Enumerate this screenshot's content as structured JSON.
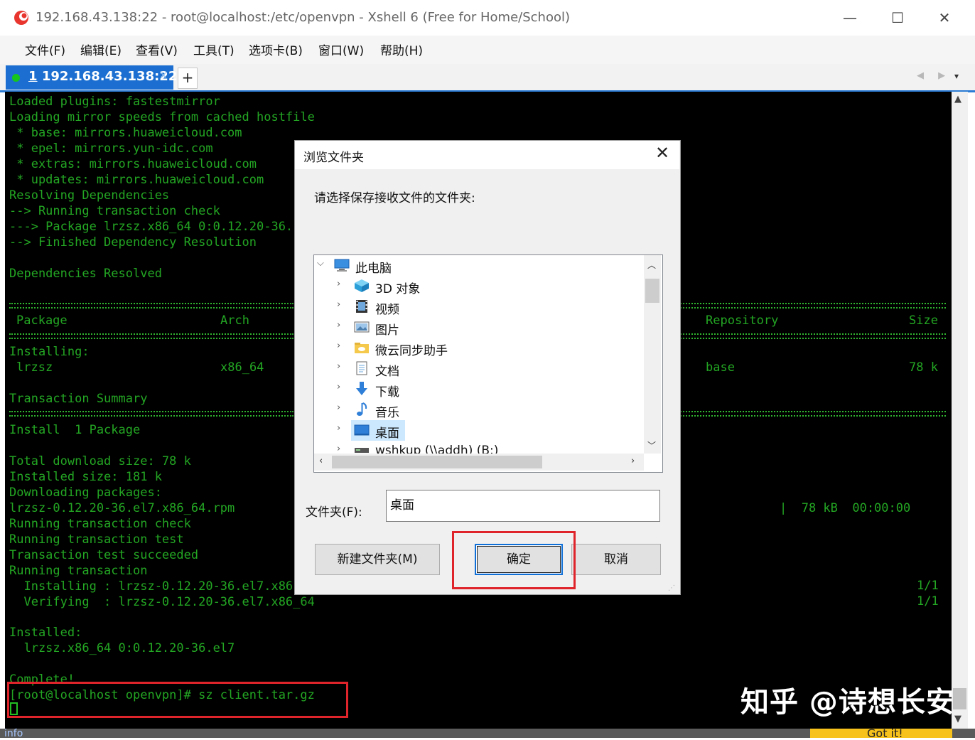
{
  "window": {
    "title": "192.168.43.138:22 - root@localhost:/etc/openvpn - Xshell 6 (Free for Home/School)",
    "minimize_label": "—",
    "maximize_label": "☐",
    "close_label": "✕"
  },
  "menu": [
    "文件(F)",
    "编辑(E)",
    "查看(V)",
    "工具(T)",
    "选项卡(B)",
    "窗口(W)",
    "帮助(H)"
  ],
  "tabs": {
    "active": {
      "index": "1",
      "host": "192.168.43.138:22",
      "close": "×"
    },
    "add_label": "+",
    "nav_label": "◀ ▶",
    "menu_label": "▾"
  },
  "terminal": {
    "lines_top": [
      "Loaded plugins: fastestmirror",
      "Loading mirror speeds from cached hostfile",
      " * base: mirrors.huaweicloud.com",
      " * epel: mirrors.yun-idc.com",
      " * extras: mirrors.huaweicloud.com",
      " * updates: mirrors.huaweicloud.com",
      "Resolving Dependencies",
      "--> Running transaction check",
      "---> Package lrzsz.x86_64 0:0.12.20-36.",
      "--> Finished Dependency Resolution"
    ],
    "deps_resolved": "Dependencies Resolved",
    "table_headers": {
      "package": "Package",
      "arch": "Arch",
      "repository": "Repository",
      "size": "Size"
    },
    "installing": "Installing:",
    "pkg": {
      "name": "lrzsz",
      "arch": "x86_64",
      "repo": "base",
      "size": "78 k"
    },
    "summary": "Transaction Summary",
    "install_count": "Install  1 Package",
    "lines_mid": [
      "Total download size: 78 k",
      "Installed size: 181 k",
      "Downloading packages:",
      "lrzsz-0.12.20-36.el7.x86_64.rpm",
      "Running transaction check",
      "Running transaction test",
      "Transaction test succeeded",
      "Running transaction",
      "  Installing : lrzsz-0.12.20-36.el7.x86",
      "  Verifying  : lrzsz-0.12.20-36.el7.x86_64"
    ],
    "download_stats": "|  78 kB  00:00:00",
    "progress_install": "1/1",
    "progress_verify": "1/1",
    "installed_header": "Installed:",
    "installed_pkg": "  lrzsz.x86_64 0:0.12.20-36.el7",
    "complete": "Complete!",
    "prompt": "[root@localhost openvpn]# sz client.tar.gz"
  },
  "watermark": "知乎 @诗想长安",
  "bottom": {
    "info": "info",
    "got_it": "Got it!"
  },
  "dialog": {
    "title": "浏览文件夹",
    "close": "✕",
    "prompt": "请选择保存接收文件的文件夹:",
    "tree": [
      {
        "label": "此电脑",
        "icon": "computer-icon",
        "expanded": true
      },
      {
        "label": "3D 对象",
        "icon": "cube-3d-icon"
      },
      {
        "label": "视频",
        "icon": "video-icon"
      },
      {
        "label": "图片",
        "icon": "pictures-icon"
      },
      {
        "label": "微云同步助手",
        "icon": "cloud-folder-icon"
      },
      {
        "label": "文档",
        "icon": "document-icon"
      },
      {
        "label": "下载",
        "icon": "download-icon"
      },
      {
        "label": "音乐",
        "icon": "music-icon"
      },
      {
        "label": "桌面",
        "icon": "desktop-icon",
        "selected": true
      },
      {
        "label": "wshkup (\\\\addh) (B:)",
        "icon": "network-drive-icon"
      }
    ],
    "folder_label": "文件夹(F):",
    "folder_value": "桌面",
    "new_folder_button": "新建文件夹(M)",
    "ok_button": "确定",
    "cancel_button": "取消"
  }
}
